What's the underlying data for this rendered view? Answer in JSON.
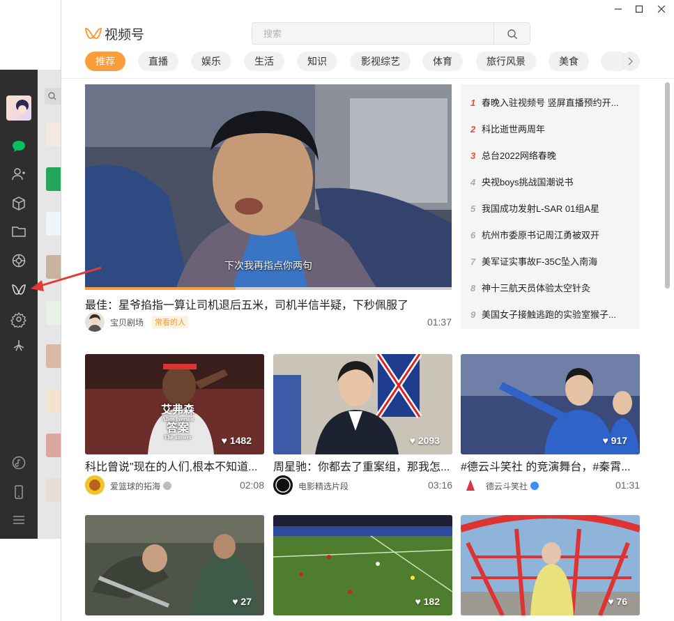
{
  "app": {
    "logo_text": "视频号"
  },
  "search": {
    "placeholder": "搜索"
  },
  "tabs": [
    "推荐",
    "直播",
    "娱乐",
    "生活",
    "知识",
    "影视综艺",
    "体育",
    "旅行风景",
    "美食"
  ],
  "active_tab_index": 0,
  "featured": {
    "subtitle": "下次我再指点你两句",
    "title": "最佳：星爷掐指一算让司机退后五米，司机半信半疑，下秒佩服了",
    "author": "宝贝剧场",
    "author_tag": "常看的人",
    "duration": "01:37",
    "progress_fraction": 0.41
  },
  "hot_list": [
    {
      "rank": "1",
      "text": "春晚入驻视频号 竖屏直播预约开..."
    },
    {
      "rank": "2",
      "text": "科比逝世两周年"
    },
    {
      "rank": "3",
      "text": "总台2022网络春晚"
    },
    {
      "rank": "4",
      "text": "央视boys挑战国潮说书"
    },
    {
      "rank": "5",
      "text": "我国成功发射L-SAR 01组A星"
    },
    {
      "rank": "6",
      "text": "杭州市委原书记周江勇被双开"
    },
    {
      "rank": "7",
      "text": "美军证实事故F-35C坠入南海"
    },
    {
      "rank": "8",
      "text": "神十三航天员体验太空针灸"
    },
    {
      "rank": "9",
      "text": "美国女子接触逃跑的实验室猴子..."
    }
  ],
  "cards": [
    {
      "likes": "1482",
      "title": "科比曾说\"现在的人们,根本不知道...",
      "author": "爱篮球的拓海",
      "duration": "02:08",
      "overlay_1": "艾弗森",
      "overlay_2": "Allen Iverson",
      "overlay_3": "答案",
      "overlay_4": "The answer"
    },
    {
      "likes": "2093",
      "title": "周星驰：你都去了重案组，那我怎...",
      "author": "电影精选片段",
      "duration": "03:16"
    },
    {
      "likes": "917",
      "title": "#德云斗笑社 的竞演舞台，#秦霄...",
      "author": "德云斗笑社",
      "duration": "01:31"
    },
    {
      "likes": "27"
    },
    {
      "likes": "182"
    },
    {
      "likes": "76"
    }
  ],
  "colors": {
    "accent": "#fa9d3b",
    "hot_rank_top": "#e94a3a",
    "verified": "#3a8ef6",
    "annotation_arrow": "#e53935"
  }
}
